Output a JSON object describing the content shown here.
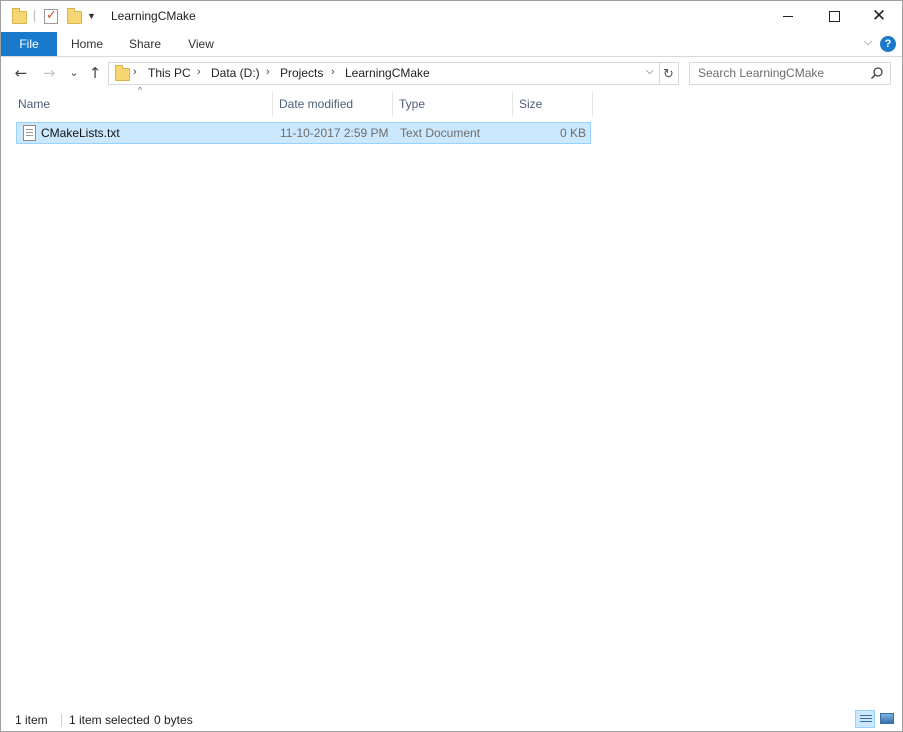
{
  "window": {
    "title": "LearningCMake",
    "minimize_glyph": "",
    "maximize_glyph": "",
    "close_glyph": "✕"
  },
  "ribbon": {
    "tabs": [
      {
        "label": "File"
      },
      {
        "label": "Home"
      },
      {
        "label": "Share"
      },
      {
        "label": "View"
      }
    ],
    "expand_glyph": "⌵",
    "help_glyph": "?"
  },
  "nav": {
    "back_glyph": "←",
    "forward_glyph": "→",
    "recent_glyph": "⌄",
    "up_glyph": "↑"
  },
  "address": {
    "breadcrumb": [
      "This PC",
      "Data (D:)",
      "Projects",
      "LearningCMake"
    ],
    "separator": "›",
    "dropdown_glyph": "⌵",
    "refresh_glyph": "↻"
  },
  "search": {
    "placeholder": "Search LearningCMake"
  },
  "columns": [
    {
      "label": "Name"
    },
    {
      "label": "Date modified"
    },
    {
      "label": "Type"
    },
    {
      "label": "Size"
    }
  ],
  "sort": {
    "column": "Name",
    "glyph": "^"
  },
  "files": [
    {
      "name": "CMakeLists.txt",
      "date_modified": "11-10-2017 2:59 PM",
      "type": "Text Document",
      "size": "0 KB",
      "selected": true,
      "icon": "text-file-icon"
    }
  ],
  "status": {
    "item_count": "1 item",
    "selection": "1 item selected",
    "selection_size": "0 bytes",
    "active_view": "details"
  },
  "colors": {
    "accent": "#1979ca",
    "selection_bg": "#cce8ff",
    "selection_border": "#99d1ff",
    "header_text": "#4c607a"
  }
}
